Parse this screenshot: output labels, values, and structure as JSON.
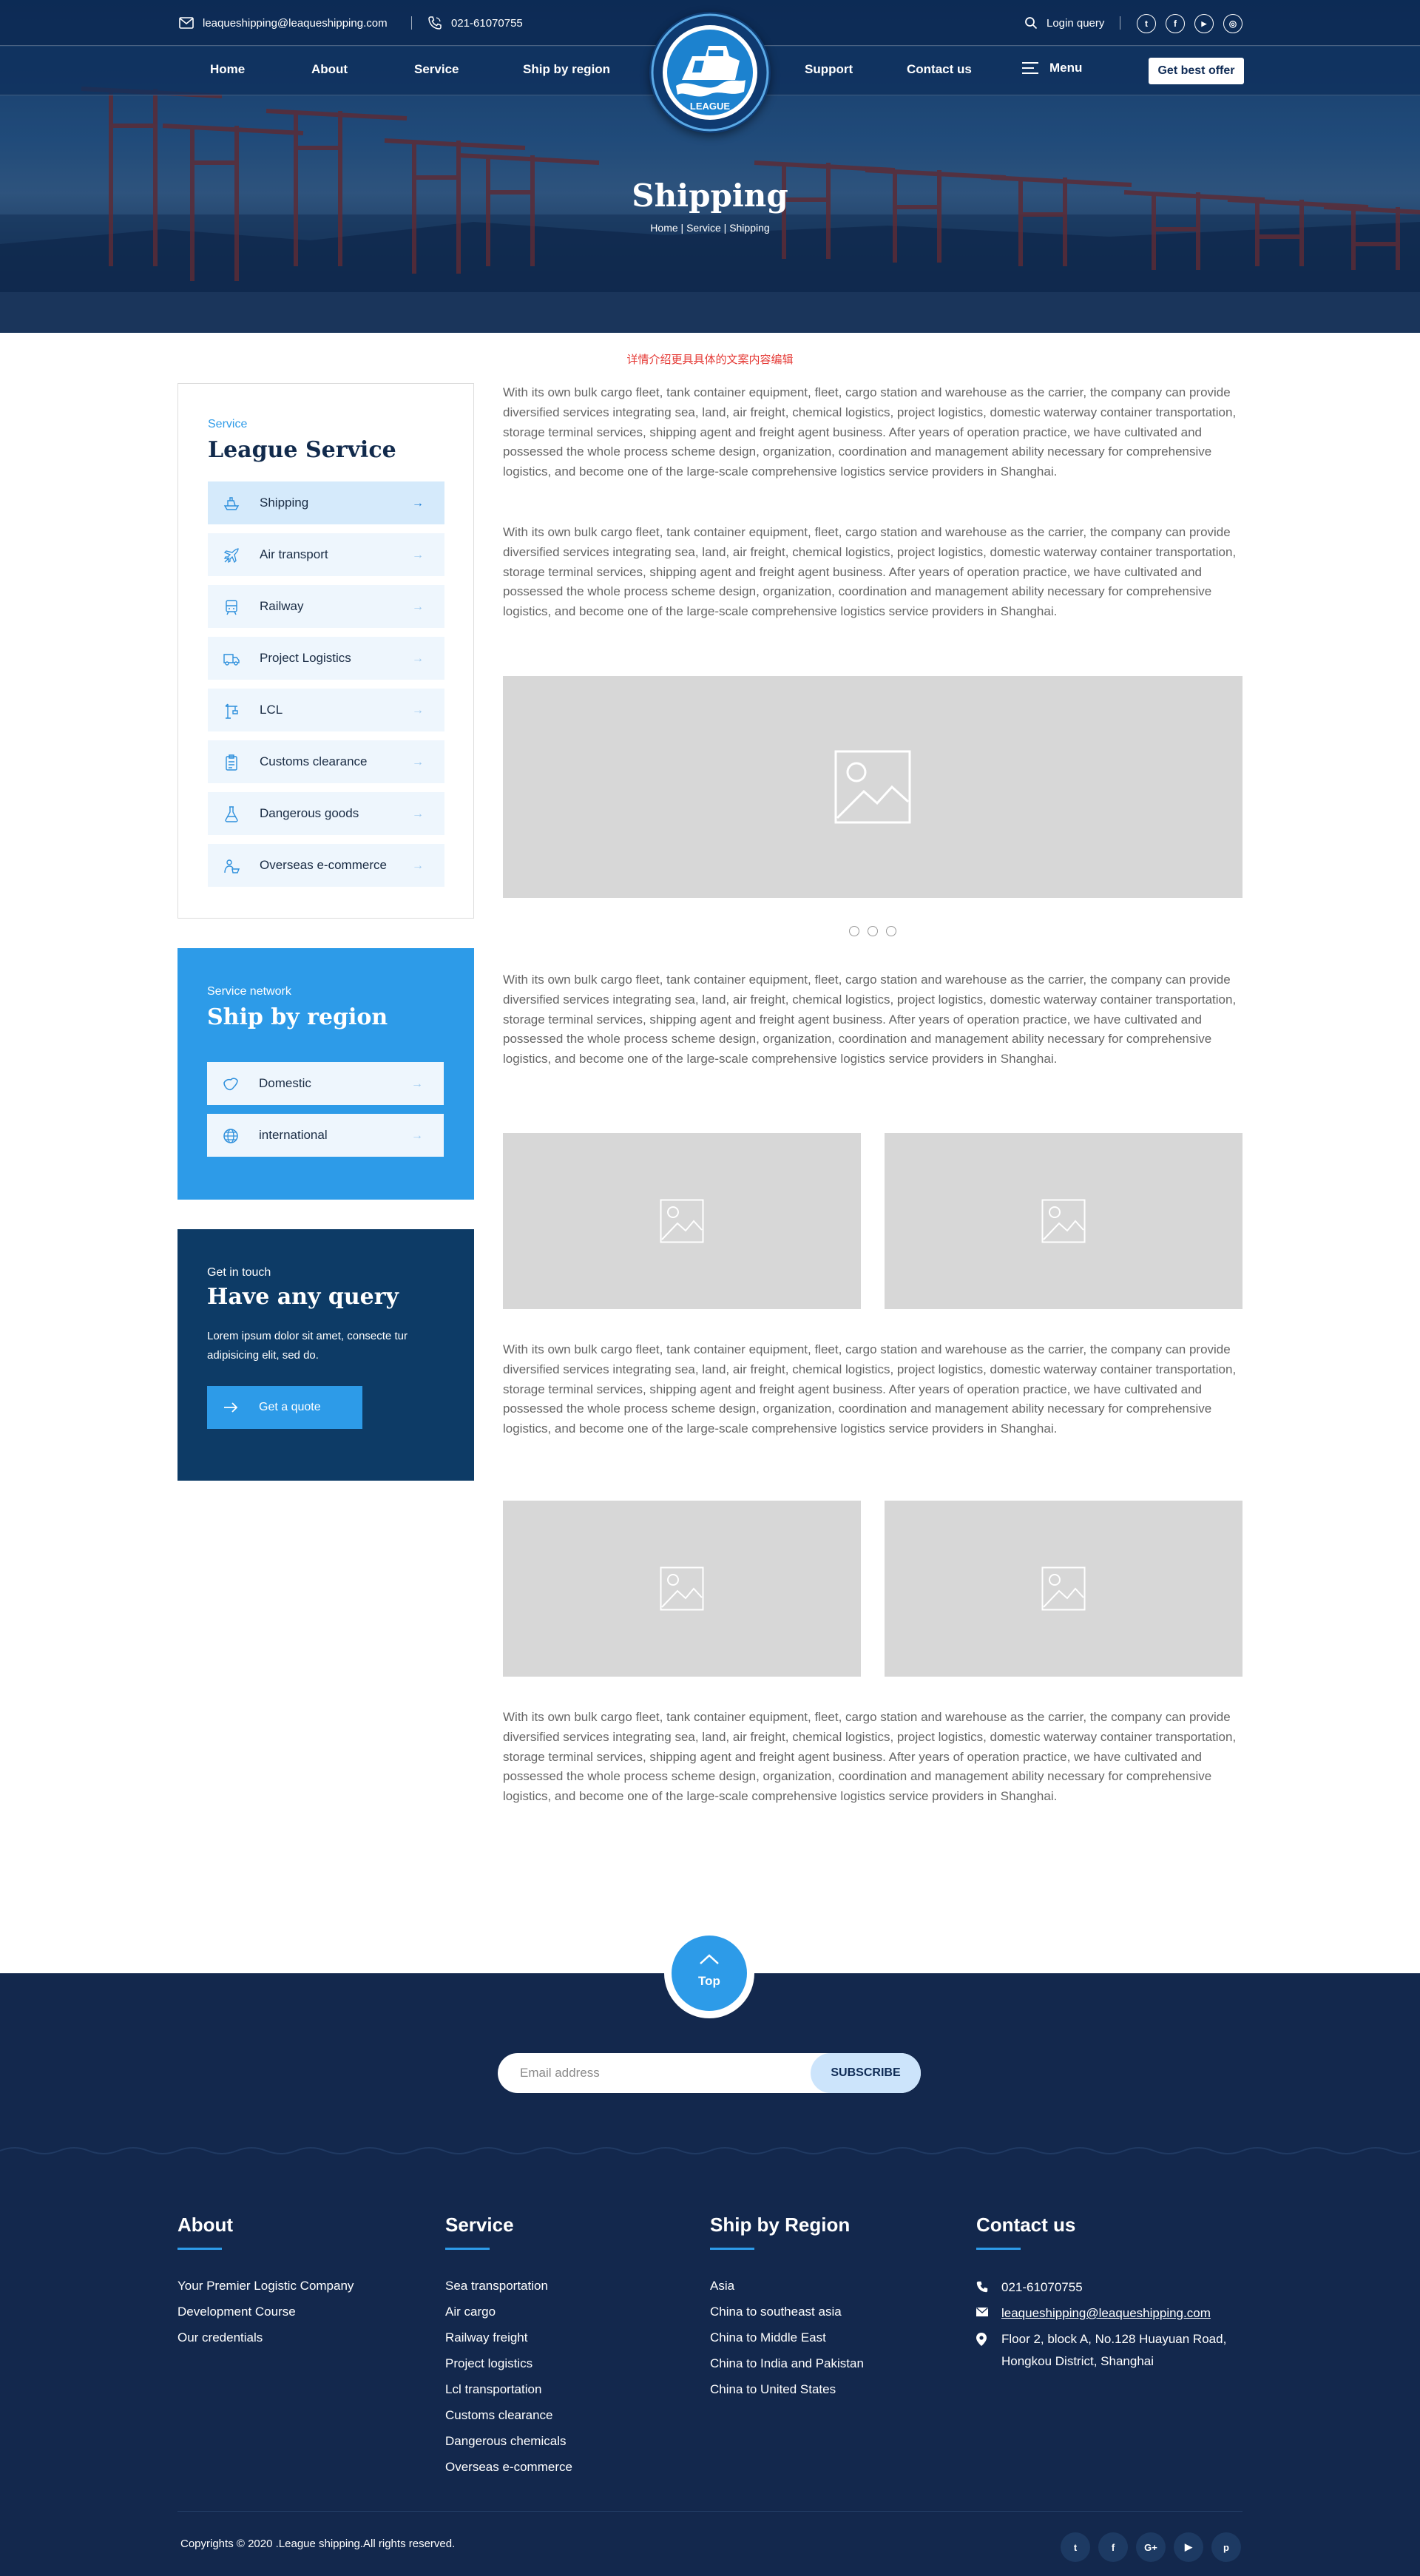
{
  "topbar": {
    "email": "leaqueshipping@leaqueshipping.com",
    "phone": "021-61070755",
    "login": "Login query",
    "social": [
      "twitter-icon",
      "facebook-icon",
      "youtube-icon",
      "instagram-icon"
    ]
  },
  "nav": {
    "items": [
      "Home",
      "About",
      "Service",
      "Ship by region",
      "Support",
      "Contact us"
    ],
    "menu": "Menu",
    "offer": "Get best offer",
    "logo_text": "LEAGUE"
  },
  "hero": {
    "title": "Shipping",
    "breadcrumb": [
      "Home",
      "Service",
      "Shipping"
    ]
  },
  "notice": "详情介绍更具具体的文案内容编辑",
  "sidebar": {
    "service": {
      "eyebrow": "Service",
      "title": "League Service",
      "items": [
        {
          "label": "Shipping",
          "icon": "ship-icon",
          "active": true
        },
        {
          "label": "Air transport",
          "icon": "plane-icon",
          "active": false
        },
        {
          "label": "Railway",
          "icon": "train-icon",
          "active": false
        },
        {
          "label": "Project Logistics",
          "icon": "truck-icon",
          "active": false
        },
        {
          "label": "LCL",
          "icon": "crane-icon",
          "active": false
        },
        {
          "label": "Customs clearance",
          "icon": "clipboard-icon",
          "active": false
        },
        {
          "label": "Dangerous goods",
          "icon": "flask-icon",
          "active": false
        },
        {
          "label": "Overseas e-commerce",
          "icon": "ecommerce-icon",
          "active": false
        }
      ]
    },
    "region": {
      "eyebrow": "Service network",
      "title": "Ship by region",
      "items": [
        {
          "label": "Domestic",
          "icon": "china-map-icon"
        },
        {
          "label": "international",
          "icon": "globe-icon"
        }
      ]
    },
    "query": {
      "eyebrow": "Get in touch",
      "title": "Have any query",
      "text": "Lorem ipsum dolor sit amet, consecte tur adipisicing elit, sed do.",
      "button": "Get a quote"
    }
  },
  "content": {
    "paragraph": "With its own bulk cargo fleet, tank container equipment, fleet, cargo station and warehouse as the carrier, the company can provide diversified services integrating sea, land, air freight, chemical logistics, project logistics, domestic waterway container transportation, storage terminal services, shipping agent and freight agent business. After years of operation practice, we have cultivated and possessed the whole process scheme design, organization, coordination and management ability necessary for comprehensive logistics, and become one of the large-scale comprehensive logistics service providers in Shanghai.",
    "slider_dots": 3
  },
  "footer": {
    "top_label": "Top",
    "email_placeholder": "Email address",
    "subscribe": "SUBSCRIBE",
    "columns": [
      {
        "title": "About",
        "links": [
          "Your Premier Logistic Company",
          "Development Course",
          "Our credentials"
        ]
      },
      {
        "title": "Service",
        "links": [
          "Sea transportation",
          "Air cargo",
          "Railway freight",
          "Project logistics",
          "Lcl transportation",
          "Customs clearance",
          "Dangerous chemicals",
          "Overseas e-commerce"
        ]
      },
      {
        "title": "Ship by Region",
        "links": [
          "Asia",
          "China to southeast asia",
          "China to Middle East",
          "China to  India and Pakistan",
          "China to  United States"
        ]
      }
    ],
    "contact": {
      "title": "Contact us",
      "phone": "021-61070755",
      "email": "leaqueshipping@leaqueshipping.com",
      "address": "Floor 2, block A, No.128 Huayuan Road, Hongkou District, Shanghai"
    },
    "copyright": "Copyrights © 2020 .League shipping.All rights reserved.",
    "social": [
      {
        "icon": "twitter-icon",
        "glyph": "t"
      },
      {
        "icon": "facebook-icon",
        "glyph": "f"
      },
      {
        "icon": "google-plus-icon",
        "glyph": "G+"
      },
      {
        "icon": "youtube-icon",
        "glyph": "▶"
      },
      {
        "icon": "pinterest-icon",
        "glyph": "p"
      }
    ]
  }
}
